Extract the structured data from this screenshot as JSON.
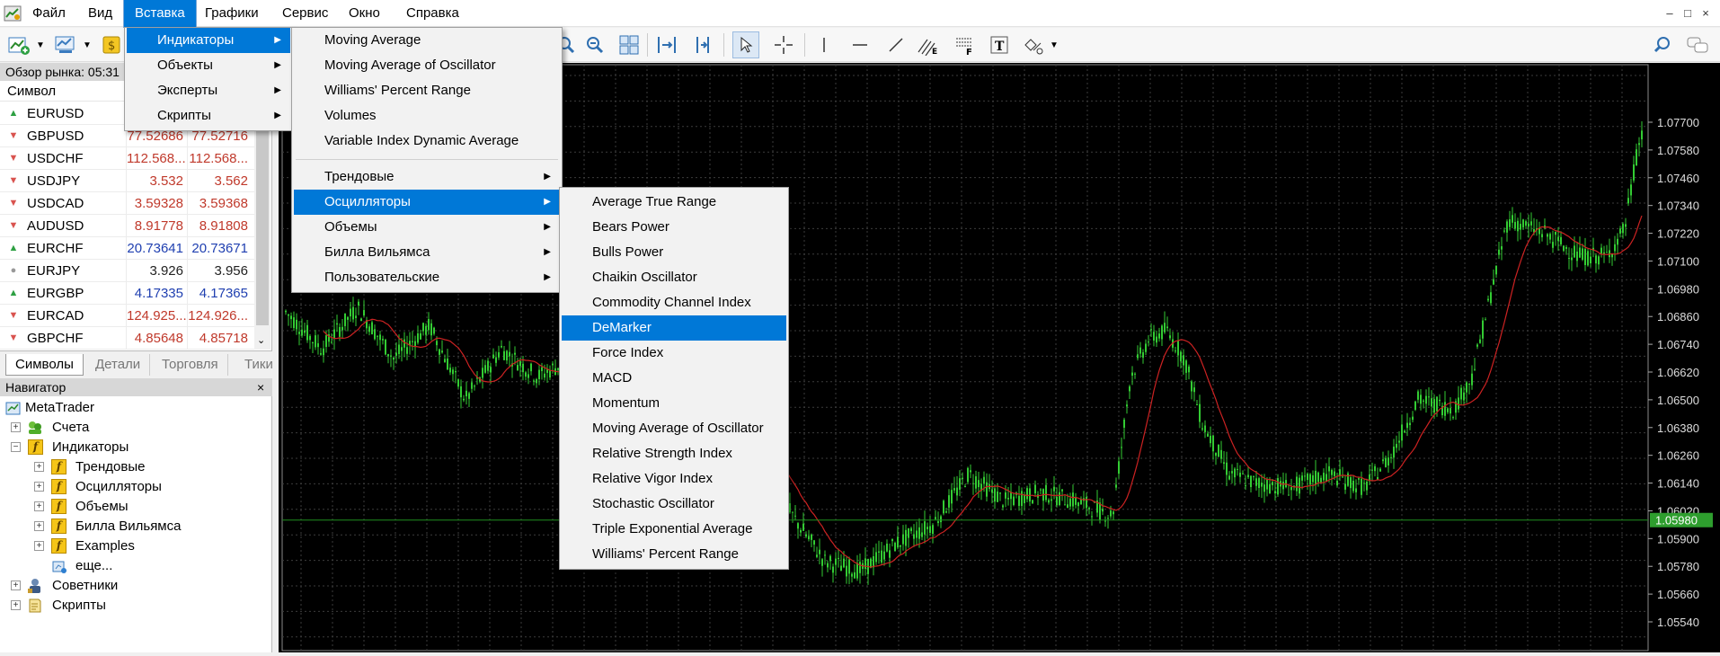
{
  "menubar": {
    "items": [
      "Файл",
      "Вид",
      "Вставка",
      "Графики",
      "Сервис",
      "Окно",
      "Справка"
    ],
    "active": "Вставка",
    "window_buttons": [
      "–",
      "□",
      "×"
    ]
  },
  "toolbar": {
    "icons": [
      "new-chart-icon",
      "profiles-icon",
      "market-watch-icon",
      "zoom-in-icon",
      "zoom-out-icon",
      "tile-windows-icon",
      "chart-shift-icon",
      "autoscroll-icon",
      "cursor-icon",
      "crosshair-icon",
      "vertical-line-icon",
      "horizontal-line-icon",
      "trendline-icon",
      "channel-icon",
      "fibonacci-icon",
      "text-icon",
      "shapes-icon",
      "search-icon",
      "chat-icon"
    ]
  },
  "market_watch": {
    "title": "Обзор рынка: 05:31",
    "column_symbol": "Символ",
    "rows": [
      {
        "symbol": "EURUSD",
        "bid": "",
        "ask": "",
        "dir": "up",
        "color": "blue"
      },
      {
        "symbol": "GBPUSD",
        "bid": "77.52686",
        "ask": "77.52716",
        "dir": "down",
        "color": "red"
      },
      {
        "symbol": "USDCHF",
        "bid": "112.568...",
        "ask": "112.568...",
        "dir": "down",
        "color": "red"
      },
      {
        "symbol": "USDJPY",
        "bid": "3.532",
        "ask": "3.562",
        "dir": "down",
        "color": "red"
      },
      {
        "symbol": "USDCAD",
        "bid": "3.59328",
        "ask": "3.59368",
        "dir": "down",
        "color": "red"
      },
      {
        "symbol": "AUDUSD",
        "bid": "8.91778",
        "ask": "8.91808",
        "dir": "down",
        "color": "red"
      },
      {
        "symbol": "EURCHF",
        "bid": "20.73641",
        "ask": "20.73671",
        "dir": "up",
        "color": "blue"
      },
      {
        "symbol": "EURJPY",
        "bid": "3.926",
        "ask": "3.956",
        "dir": "neutral",
        "color": "dark"
      },
      {
        "symbol": "EURGBP",
        "bid": "4.17335",
        "ask": "4.17365",
        "dir": "up",
        "color": "blue"
      },
      {
        "symbol": "EURCAD",
        "bid": "124.925...",
        "ask": "124.926...",
        "dir": "down",
        "color": "red"
      },
      {
        "symbol": "GBPCHF",
        "bid": "4.85648",
        "ask": "4.85718",
        "dir": "down",
        "color": "red"
      }
    ],
    "tabs": [
      "Символы",
      "Детали",
      "Торговля",
      "Тики"
    ],
    "active_tab": "Символы"
  },
  "navigator": {
    "title": "Навигатор",
    "close": "×",
    "root": "MetaTrader",
    "accounts": "Счета",
    "indicators": "Индикаторы",
    "indicator_groups": [
      "Трендовые",
      "Осцилляторы",
      "Объемы",
      "Билла Вильямса",
      "Examples"
    ],
    "more": "еще...",
    "experts": "Советники",
    "scripts": "Скрипты"
  },
  "insert_menu": {
    "items": [
      "Индикаторы",
      "Объекты",
      "Эксперты",
      "Скрипты"
    ],
    "highlighted": "Индикаторы"
  },
  "indicators_menu": {
    "top_items": [
      "Moving Average",
      "Moving Average of Oscillator",
      "Williams' Percent Range",
      "Volumes",
      "Variable Index Dynamic Average"
    ],
    "groups": [
      "Трендовые",
      "Осцилляторы",
      "Объемы",
      "Билла Вильямса",
      "Пользовательские"
    ],
    "highlighted": "Осцилляторы"
  },
  "oscillators_menu": {
    "items": [
      "Average True Range",
      "Bears Power",
      "Bulls Power",
      "Chaikin Oscillator",
      "Commodity Channel Index",
      "DeMarker",
      "Force Index",
      "MACD",
      "Momentum",
      "Moving Average of Oscillator",
      "Relative Strength Index",
      "Relative Vigor Index",
      "Stochastic Oscillator",
      "Triple Exponential Average",
      "Williams' Percent Range"
    ],
    "highlighted": "DeMarker"
  },
  "chart": {
    "price_labels": [
      "1.07700",
      "1.07580",
      "1.07460",
      "1.07340",
      "1.07220",
      "1.07100",
      "1.06980",
      "1.06860",
      "1.06740",
      "1.06620",
      "1.06500",
      "1.06380",
      "1.06260",
      "1.06140",
      "1.06020",
      "1.05900",
      "1.05780",
      "1.05660",
      "1.05540"
    ],
    "current_price": "1.05980",
    "colors": {
      "background": "#000000",
      "grid": "#3c3c3c",
      "candles": "#33cc33",
      "ma": "#cc2222",
      "price_line": "#1f8f1f",
      "price_tag": "#2e9e2e"
    }
  }
}
